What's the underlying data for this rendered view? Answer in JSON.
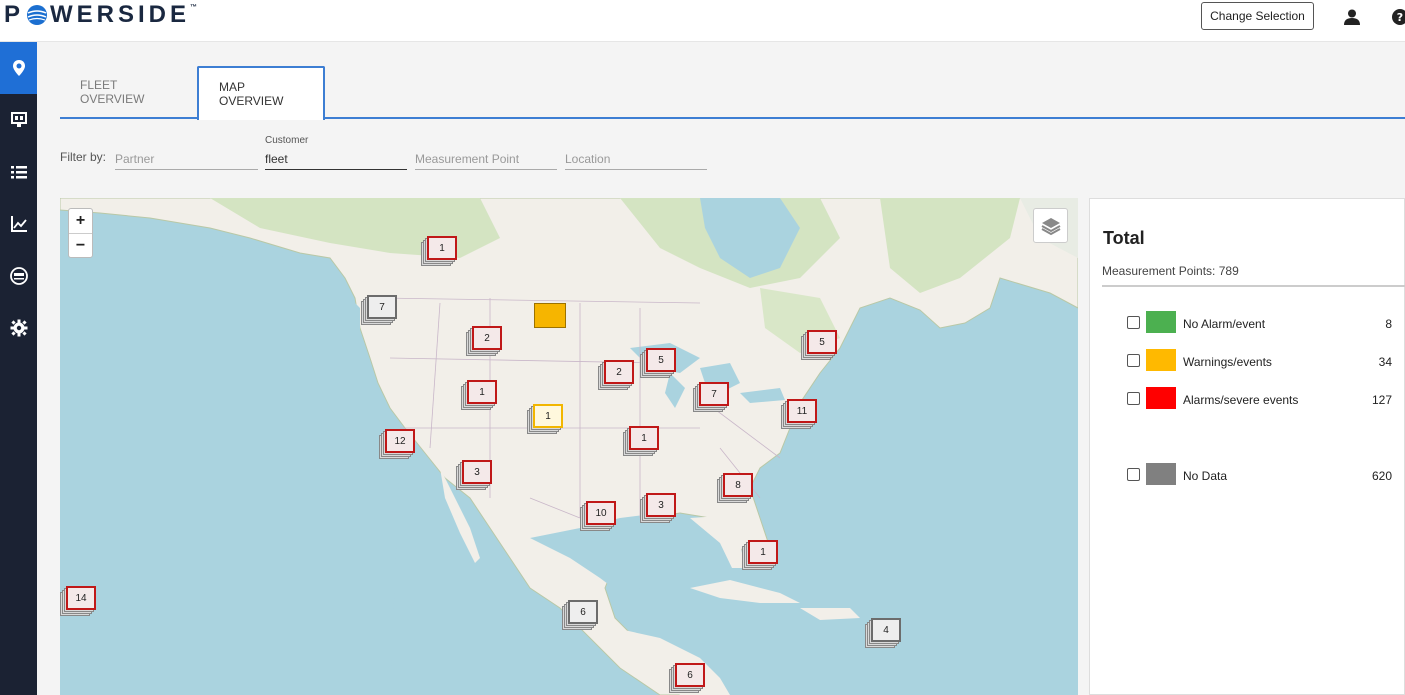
{
  "header": {
    "logo_text_before": "P",
    "logo_text_after": "WERSIDE",
    "logo_mark": "™",
    "change_selection_label": "Change Selection",
    "user_icon": "user-icon",
    "help_icon": "help-icon"
  },
  "sidebar": {
    "items": [
      {
        "icon": "map-pin-icon",
        "active": true
      },
      {
        "icon": "monitor-icon",
        "active": false
      },
      {
        "icon": "list-icon",
        "active": false
      },
      {
        "icon": "chart-icon",
        "active": false
      },
      {
        "icon": "meter-icon",
        "active": false
      },
      {
        "icon": "gear-icon",
        "active": false
      }
    ]
  },
  "tabs": [
    {
      "label": "FLEET OVERVIEW",
      "active": false
    },
    {
      "label": "MAP OVERVIEW",
      "active": true
    }
  ],
  "filter": {
    "label": "Filter by:",
    "partner_placeholder": "Partner",
    "customer_label": "Customer",
    "customer_value": "fleet",
    "measurement_point_placeholder": "Measurement Point",
    "location_placeholder": "Location"
  },
  "map": {
    "zoom_in": "+",
    "zoom_out": "−",
    "layers_icon": "layers-icon",
    "clusters": [
      {
        "count": "1",
        "style": "red"
      },
      {
        "count": "7",
        "style": "grey"
      },
      {
        "count": "2",
        "style": "red"
      },
      {
        "count": "5",
        "style": "red"
      },
      {
        "count": "2",
        "style": "red"
      },
      {
        "count": "5",
        "style": "red"
      },
      {
        "count": "1",
        "style": "red"
      },
      {
        "count": "7",
        "style": "red"
      },
      {
        "count": "1",
        "style": "yellow"
      },
      {
        "count": "11",
        "style": "red"
      },
      {
        "count": "12",
        "style": "red"
      },
      {
        "count": "1",
        "style": "red"
      },
      {
        "count": "3",
        "style": "red"
      },
      {
        "count": "8",
        "style": "red"
      },
      {
        "count": "3",
        "style": "red"
      },
      {
        "count": "10",
        "style": "red"
      },
      {
        "count": "1",
        "style": "red"
      },
      {
        "count": "14",
        "style": "red"
      },
      {
        "count": "6",
        "style": "grey"
      },
      {
        "count": "4",
        "style": "grey"
      },
      {
        "count": "6",
        "style": "red"
      }
    ]
  },
  "legend": {
    "title": "Total",
    "measurement_points_label": "Measurement Points: 789",
    "rows": [
      {
        "label": "No Alarm/event",
        "count": "8",
        "color": "#4cb050"
      },
      {
        "label": "Warnings/events",
        "count": "34",
        "color": "#ffb900"
      },
      {
        "label": "Alarms/severe events",
        "count": "127",
        "color": "#ff0000"
      },
      {
        "label": "No Data",
        "count": "620",
        "color": "#808080"
      }
    ]
  },
  "colors": {
    "accent": "#3d7ed3",
    "sidebar": "#1b2233",
    "active_sidebar": "#1f6fd6",
    "water": "#aad3df",
    "land": "#f2efe9"
  }
}
